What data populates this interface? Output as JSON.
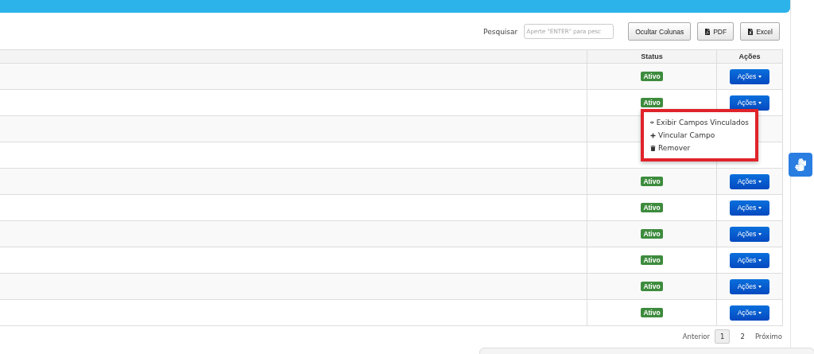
{
  "toolbar": {
    "search_label": "Pesquisar",
    "search_placeholder": "Aperte \"ENTER\" para pesc",
    "buttons": [
      {
        "kind": "text",
        "label": "Ocultar Colunas"
      },
      {
        "kind": "pdf",
        "label": "PDF"
      },
      {
        "kind": "excel",
        "label": "Excel"
      }
    ]
  },
  "table": {
    "columns": [
      "Status",
      "Ações"
    ],
    "rows": [
      {
        "status": "Ativo",
        "action": "Ações"
      },
      {
        "status": "Ativo",
        "action": "Ações",
        "menu_open": true
      },
      {},
      {},
      {
        "status": "Ativo",
        "action": "Ações"
      },
      {
        "status": "Ativo",
        "action": "Ações"
      },
      {
        "status": "Ativo",
        "action": "Ações"
      },
      {
        "status": "Ativo",
        "action": "Ações"
      },
      {
        "status": "Ativo",
        "action": "Ações"
      },
      {
        "status": "Ativo",
        "action": "Ações"
      }
    ]
  },
  "menu": {
    "items": [
      {
        "kind": "view",
        "label": "Exibir Campos Vinculados"
      },
      {
        "kind": "add",
        "label": "Vincular Campo"
      },
      {
        "kind": "delete",
        "label": "Remover"
      }
    ]
  },
  "pagination": {
    "previous": "Anterior",
    "pages": [
      {
        "label": "1",
        "selected": true
      },
      {
        "label": "2",
        "selected": false
      }
    ],
    "next": "Próximo"
  }
}
